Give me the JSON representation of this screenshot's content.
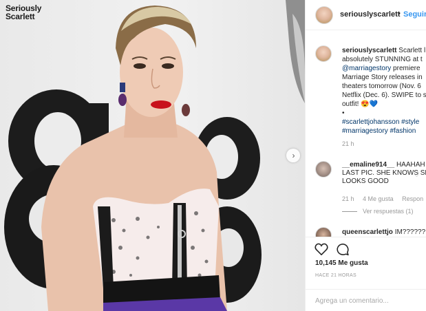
{
  "photo": {
    "watermark_line1": "Seriously",
    "watermark_line2": "Scarlett",
    "next_icon": "chevron-right-icon"
  },
  "header": {
    "username": "seriouslyscarlett",
    "separator": "•",
    "follow_label": "Seguir"
  },
  "caption": {
    "username": "seriouslyscarlett",
    "line1_rest": " Scarlett l",
    "line2": "absolutely STUNNING at t",
    "line3_link": "@marriagestory",
    "line3_rest": " premiere",
    "line4": "Marriage Story releases in",
    "line5": "theaters tomorrow (Nov. 6",
    "line6": "Netflix (Dec. 6). SWIPE to s",
    "line7": "outfit! 😍💙",
    "line8": "•",
    "tags1": "#scarlettjohansson #style",
    "tags2": "#marriagestory #fashion",
    "time": "21 h"
  },
  "comment1": {
    "username": "__emaline914__",
    "text1": " HAAHAH",
    "text2": "LAST PIC. SHE KNOWS SH",
    "text3": "LOOKS GOOD",
    "time": "21 h",
    "likes": "4 Me gusta",
    "reply": "Respon",
    "view_replies": "Ver respuestas (1)"
  },
  "comment2": {
    "username": "queenscarlettjo",
    "text": " IM??????"
  },
  "actions": {
    "like_icon": "heart-icon",
    "comment_icon": "comment-icon"
  },
  "likes_count": "10,145 Me gusta",
  "time_ago": "HACE 21 HORAS",
  "add_comment_placeholder": "Agrega un comentario..."
}
